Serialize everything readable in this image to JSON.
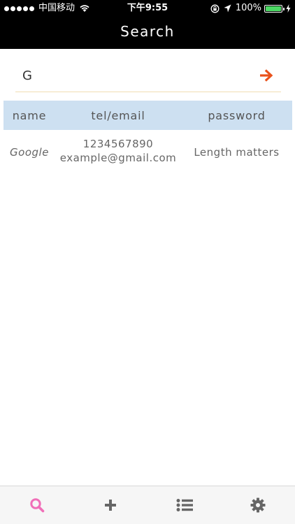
{
  "status_bar": {
    "carrier": "中国移动",
    "time": "下午9:55",
    "battery_percent": "100%",
    "battery_level": 1.0
  },
  "nav": {
    "title": "Search"
  },
  "search": {
    "value": "G",
    "go_icon": "arrow-right-icon",
    "accent_color": "#e9531d"
  },
  "table": {
    "headers": {
      "name": "name",
      "contact": "tel/email",
      "password": "password"
    },
    "header_bg": "#cde0f1",
    "rows": [
      {
        "name": "Google",
        "tel": "1234567890",
        "email": "example@gmail.com",
        "password": "Length matters"
      }
    ]
  },
  "tab_bar": {
    "active_color": "#f06fb8",
    "inactive_color": "#666666",
    "tabs": [
      {
        "icon": "search-icon",
        "active": true
      },
      {
        "icon": "plus-icon",
        "active": false
      },
      {
        "icon": "list-icon",
        "active": false
      },
      {
        "icon": "gear-icon",
        "active": false
      }
    ]
  }
}
